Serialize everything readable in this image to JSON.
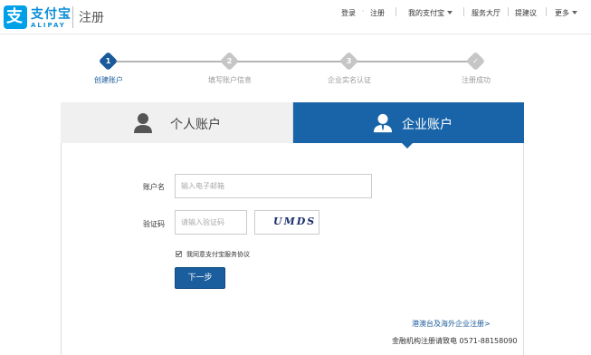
{
  "header": {
    "brand_cn": "支付宝",
    "brand_en": "ALIPAY",
    "page_title": "注册",
    "logo_glyph": "支"
  },
  "topnav": {
    "login": "登录",
    "register": "注册",
    "my_alipay": "我的支付宝",
    "service_hall": "服务大厅",
    "suggestions": "提建议",
    "more": "更多"
  },
  "steps": [
    {
      "num": "1",
      "label": "创建账户",
      "active": true
    },
    {
      "num": "2",
      "label": "填写账户信息",
      "active": false
    },
    {
      "num": "3",
      "label": "企业实名认证",
      "active": false
    },
    {
      "num": "",
      "label": "注册成功",
      "active": false
    }
  ],
  "tabs": {
    "personal": "个人账户",
    "enterprise": "企业账户"
  },
  "form": {
    "account_label": "账户名",
    "account_placeholder": "输入电子邮箱",
    "captcha_label": "验证码",
    "captcha_placeholder": "请输入验证码",
    "captcha_text": "UMDS",
    "agree_text": "我同意支付宝服务协议",
    "next_button": "下一步"
  },
  "footer": {
    "foreign_link": "港澳台及海外企业注册>",
    "hotline": "金融机构注册请致电 0571-88158090"
  },
  "colors": {
    "brand": "#00a0e9",
    "accent": "#1964a8",
    "link": "#1a5a9a"
  }
}
